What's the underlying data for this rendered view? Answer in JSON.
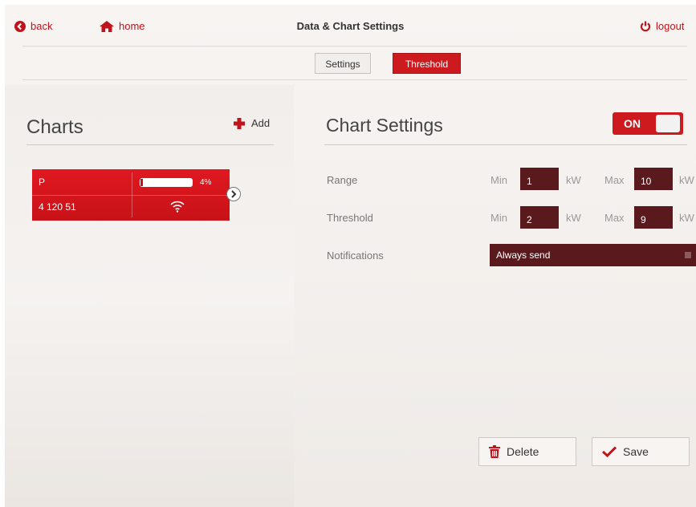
{
  "header": {
    "back_label": "back",
    "home_label": "home",
    "title": "Data & Chart Settings",
    "logout_label": "logout"
  },
  "tabs": [
    {
      "label": "Settings",
      "active": false
    },
    {
      "label": "Threshold",
      "active": true
    }
  ],
  "charts_panel": {
    "title": "Charts",
    "add_label": "Add",
    "card": {
      "name": "P",
      "battery_level": 4,
      "battery_text": "4%",
      "id": "4 120 51",
      "signal_icon": "wifi-icon"
    }
  },
  "settings_panel": {
    "title": "Chart Settings",
    "toggle_label": "ON",
    "range": {
      "label": "Range",
      "min_label": "Min",
      "min_value": "1",
      "min_unit": "kW",
      "max_label": "Max",
      "max_value": "10",
      "max_unit": "kW"
    },
    "threshold": {
      "label": "Threshold",
      "min_label": "Min",
      "min_value": "2",
      "min_unit": "kW",
      "max_label": "Max",
      "max_value": "9",
      "max_unit": "kW"
    },
    "notifications": {
      "label": "Notifications",
      "value": "Always send"
    },
    "delete_label": "Delete",
    "save_label": "Save"
  },
  "colors": {
    "accent": "#cc1a1f",
    "input_bg": "#5a1a1d"
  }
}
